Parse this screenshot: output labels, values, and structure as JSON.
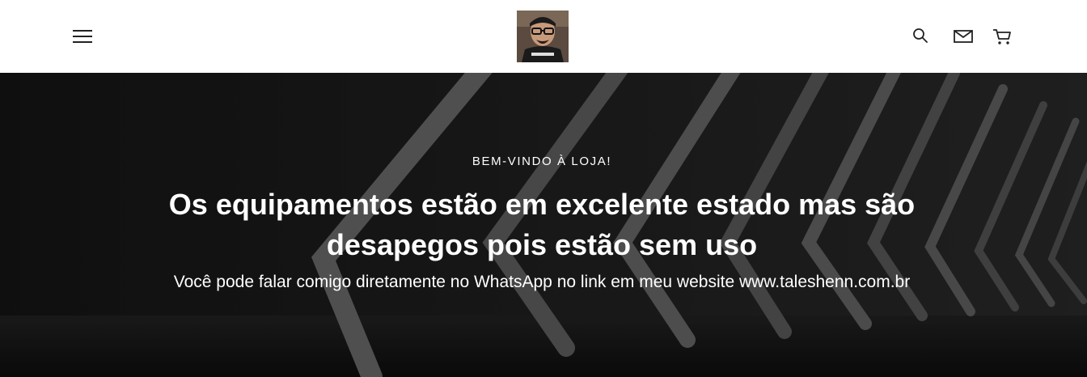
{
  "header": {
    "menu_icon": "hamburger-menu-icon",
    "logo_alt": "Profile photo of store owner",
    "icons": [
      "search-icon",
      "mail-icon",
      "cart-icon"
    ]
  },
  "hero": {
    "eyebrow": "BEM-VINDO À LOJA!",
    "headline": "Os equipamentos estão em excelente estado mas são desapegos pois estão sem uso",
    "subline": "Você pode falar comigo diretamente no WhatsApp no link em meu website www.taleshenn.com.br"
  },
  "colors": {
    "header_bg": "#ffffff",
    "hero_bg": "#1c1c1c",
    "hero_text": "#ffffff",
    "icon": "#222222"
  }
}
